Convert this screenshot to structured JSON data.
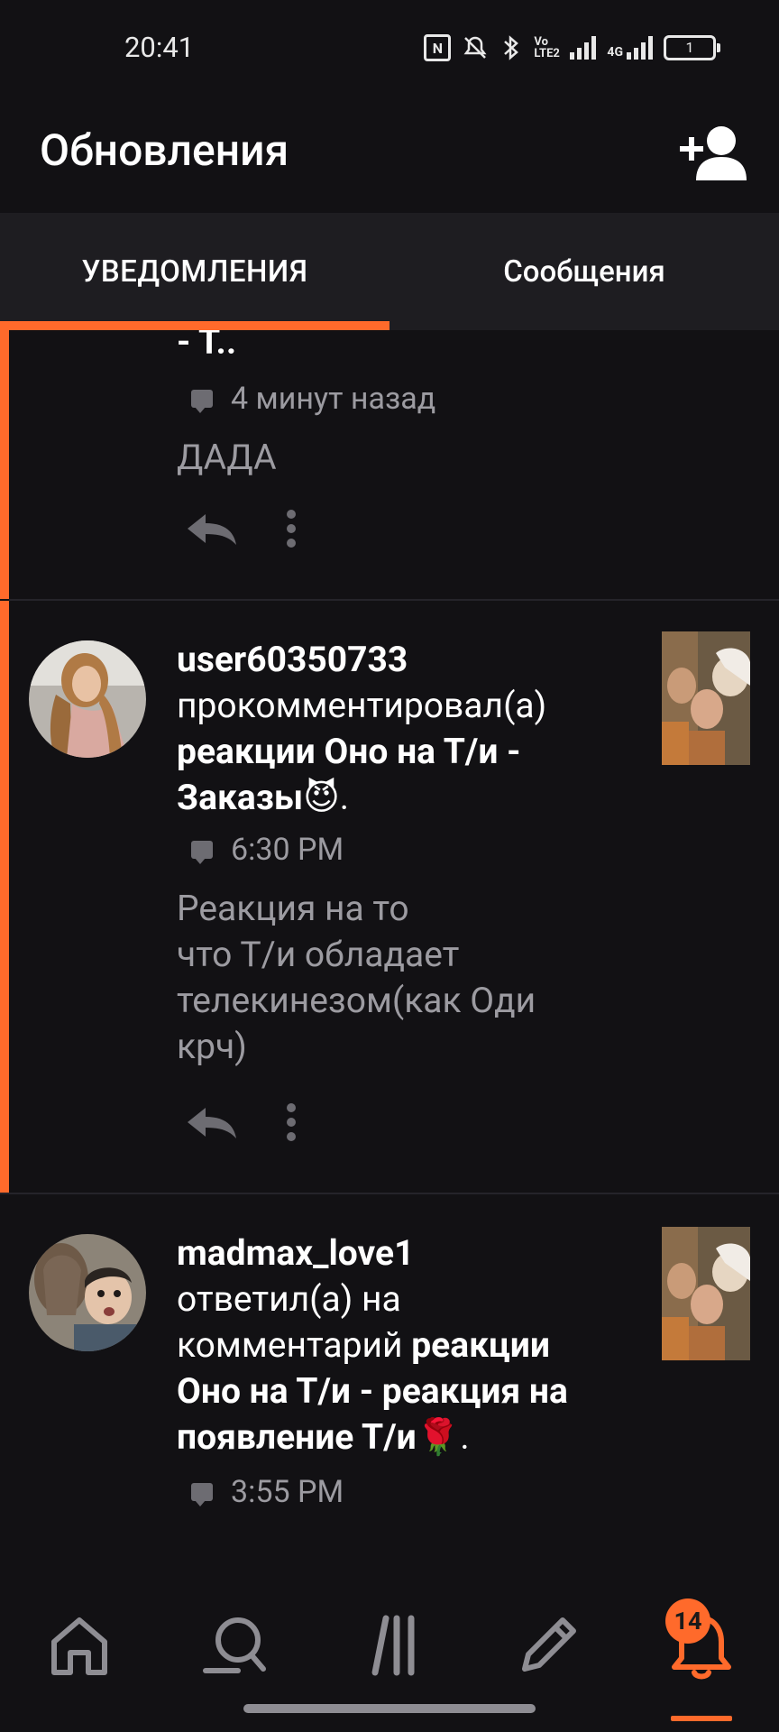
{
  "status_bar": {
    "time": "20:41",
    "icons": [
      "nfc-icon",
      "mute-icon",
      "bluetooth-icon",
      "volte-icon",
      "signal-icon",
      "4g-signal-icon",
      "battery-icon"
    ],
    "volte": "Vo LTE2",
    "network": "4G",
    "nfc": "N",
    "battery": "1"
  },
  "header": {
    "title": "Обновления",
    "action_icon": "add-friend-icon"
  },
  "tabs": {
    "notifications": "УВЕДОМЛЕНИЯ",
    "messages": "Сообщения",
    "active": "notifications"
  },
  "notifications": [
    {
      "partial_title": "- Т..",
      "time": "4 минут назад",
      "comment": "ДАДА",
      "unread": true
    },
    {
      "username": "user60350733",
      "action": "прокомментировал(а)",
      "target": "реакции Оно на Т/и - Заказы😈",
      "target_suffix": ".",
      "time": "6:30 PM",
      "comment_lines": [
        "Реакция на то",
        "что Т/и обладает",
        "телекинезом(как Оди",
        "крч)"
      ],
      "unread": true
    },
    {
      "username": "madmax_love1",
      "action_line1": "ответил(а) на",
      "action_line2_prefix": "комментарий ",
      "target_part1": "реакции",
      "target_part2": "Оно на Т/и - реакция на",
      "target_part3": "появление Т/и🌹",
      "target_suffix": ".",
      "time": "3:55 PM",
      "unread": false
    }
  ],
  "bottom_nav": {
    "items": [
      "home-icon",
      "search-icon",
      "library-icon",
      "write-icon",
      "notifications-icon"
    ],
    "badge": "14",
    "active": "notifications-icon"
  },
  "colors": {
    "accent": "#ff6a2b",
    "background": "#121114",
    "tab_bar": "#1e1d21",
    "muted_text": "#9c9ba1"
  }
}
